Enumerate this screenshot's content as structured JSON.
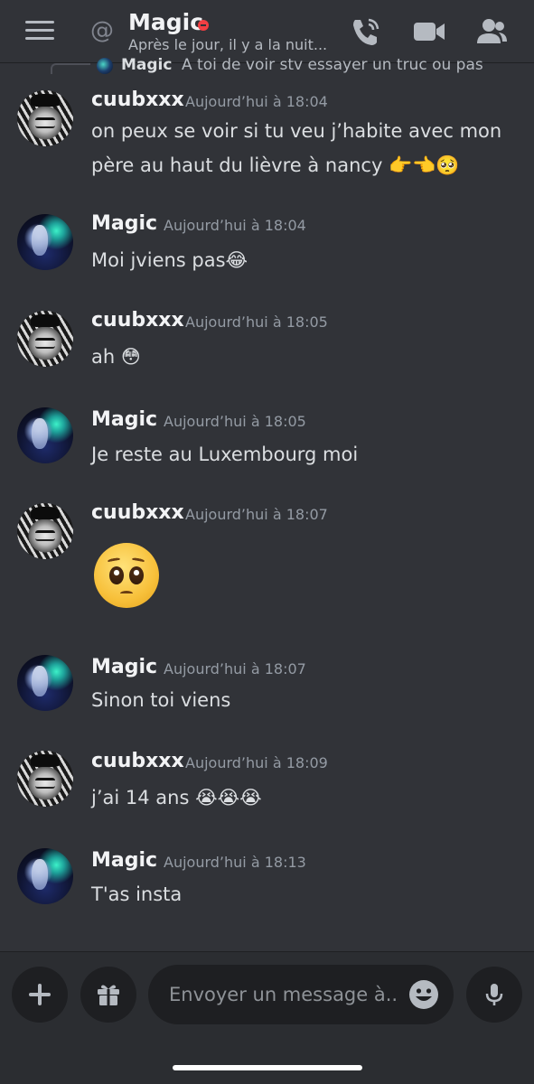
{
  "header": {
    "channel_name": "Magic",
    "status_text": "Après le jour, il y a la nuit...",
    "icons": [
      "menu-icon",
      "at-icon",
      "call-icon",
      "video-icon",
      "members-icon"
    ],
    "status_color": "#f23f43"
  },
  "reply": {
    "author": "Magic",
    "text": "A toi de voir stv essayer un truc ou pas"
  },
  "messages": [
    {
      "author": "cuubxxx",
      "timestamp": "Aujourd’hui à 18:04",
      "text": "on peux se voir si tu veu j’habite avec mon père au haut du lièvre à nancy 👉👈🥺"
    },
    {
      "author": "Magic",
      "timestamp": "Aujourd’hui à 18:04",
      "text": "Moi jviens pas😂"
    },
    {
      "author": "cuubxxx",
      "timestamp": "Aujourd’hui à 18:05",
      "text": "ah 😳"
    },
    {
      "author": "Magic",
      "timestamp": "Aujourd’hui à 18:05",
      "text": "Je reste au Luxembourg moi"
    },
    {
      "author": "cuubxxx",
      "timestamp": "Aujourd’hui à 18:07",
      "text": "🥺"
    },
    {
      "author": "Magic",
      "timestamp": "Aujourd’hui à 18:07",
      "text": "Sinon toi viens"
    },
    {
      "author": "cuubxxx",
      "timestamp": "Aujourd’hui à 18:09",
      "text": "j’ai 14 ans 😭😭😭"
    },
    {
      "author": "Magic",
      "timestamp": "Aujourd’hui à 18:13",
      "text": "T'as insta"
    }
  ],
  "composer": {
    "placeholder": "Envoyer un message à..."
  },
  "colors": {
    "background": "#313338",
    "composer_background": "#2b2d31",
    "input_background": "#1e1f22"
  }
}
